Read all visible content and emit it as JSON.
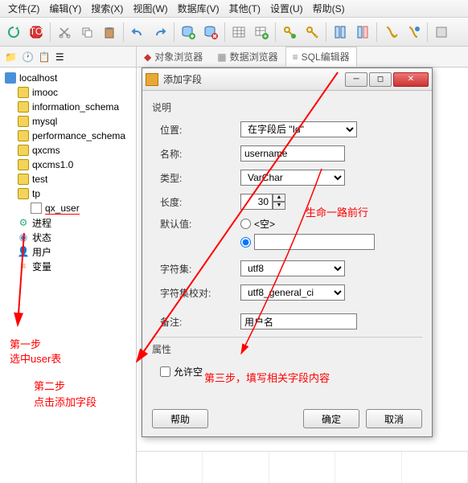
{
  "menubar": [
    "文件(Z)",
    "编辑(Y)",
    "搜索(X)",
    "视图(W)",
    "数据库(V)",
    "其他(T)",
    "设置(U)",
    "帮助(S)"
  ],
  "tabs": {
    "obj": "对象浏览器",
    "data": "数据浏览器",
    "sql": "SQL编辑器"
  },
  "tree": {
    "host": "localhost",
    "dbs": [
      "imooc",
      "information_schema",
      "mysql",
      "performance_schema",
      "qxcms",
      "qxcms1.0",
      "test",
      "tp"
    ],
    "selected": "qx_user",
    "extra": [
      "进程",
      "状态",
      "用户",
      "变量"
    ]
  },
  "dialog": {
    "title": "添加字段",
    "section_desc": "说明",
    "labels": {
      "pos": "位置:",
      "name": "名称:",
      "type": "类型:",
      "length": "长度:",
      "default": "默认值:",
      "charset": "字符集:",
      "collation": "字符集校对:",
      "comment": "备注:"
    },
    "pos_value": "在字段后 \"Id\"",
    "name_value": "username",
    "type_value": "VarChar",
    "length_value": "30",
    "default_empty_label": "<空>",
    "charset_value": "utf8",
    "collation_value": "utf8_general_ci",
    "comment_value": "用户名",
    "section_attr": "属性",
    "allow_null": "允许空",
    "btn_help": "帮助",
    "btn_ok": "确定",
    "btn_cancel": "取消"
  },
  "annotations": {
    "watermark": "生命一路前行",
    "step1a": "第一步",
    "step1b": "选中user表",
    "step2a": "第二步",
    "step2b": "点击添加字段",
    "step3": "第三步，填写相关字段内容"
  }
}
